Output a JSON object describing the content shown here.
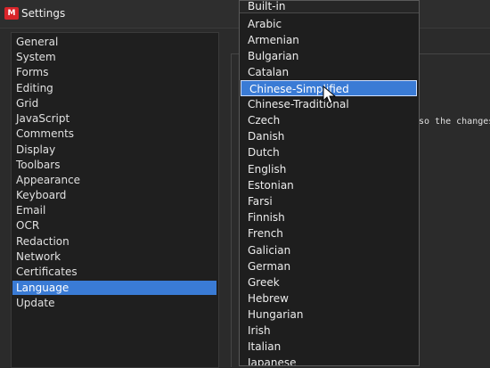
{
  "window": {
    "title": "Settings",
    "app_icon": "app-logo-icon"
  },
  "sidebar": {
    "items": [
      {
        "label": "General"
      },
      {
        "label": "System"
      },
      {
        "label": "Forms"
      },
      {
        "label": "Editing"
      },
      {
        "label": "Grid"
      },
      {
        "label": "JavaScript"
      },
      {
        "label": "Comments"
      },
      {
        "label": "Display"
      },
      {
        "label": "Toolbars"
      },
      {
        "label": "Appearance"
      },
      {
        "label": "Keyboard"
      },
      {
        "label": "Email"
      },
      {
        "label": "OCR"
      },
      {
        "label": "Redaction"
      },
      {
        "label": "Network"
      },
      {
        "label": "Certificates"
      },
      {
        "label": "Language"
      },
      {
        "label": "Update"
      }
    ],
    "selected": "Language"
  },
  "content": {
    "partial_text": "so the changes"
  },
  "dropdown": {
    "header": "Built-in",
    "hover": "Chinese-Simplified",
    "options": [
      "Arabic",
      "Armenian",
      "Bulgarian",
      "Catalan",
      "Chinese-Simplified",
      "Chinese-Traditional",
      "Czech",
      "Danish",
      "Dutch",
      "English",
      "Estonian",
      "Farsi",
      "Finnish",
      "French",
      "Galician",
      "German",
      "Greek",
      "Hebrew",
      "Hungarian",
      "Irish",
      "Italian",
      "Japanese"
    ]
  },
  "colors": {
    "selection": "#3a7bd5",
    "background": "#2b2b2b",
    "sidebar": "#1f1f1f"
  }
}
